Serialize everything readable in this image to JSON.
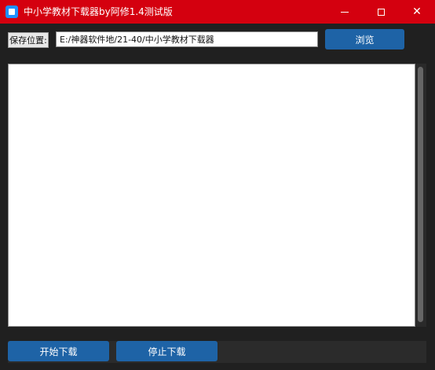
{
  "window": {
    "title": "中小学教材下载器by阿修1.4测试版",
    "minimize_glyph": "",
    "maximize_glyph": "",
    "close_glyph": "✕",
    "titlebar_color": "#d4000f"
  },
  "path_row": {
    "label": "保存位置:",
    "value": "E:/神器软件地/21-40/中小学教材下载器",
    "browse_label": "浏览"
  },
  "actions": {
    "start_label": "开始下载",
    "stop_label": "停止下载"
  },
  "colors": {
    "accent": "#1e63a6",
    "background": "#202020"
  }
}
